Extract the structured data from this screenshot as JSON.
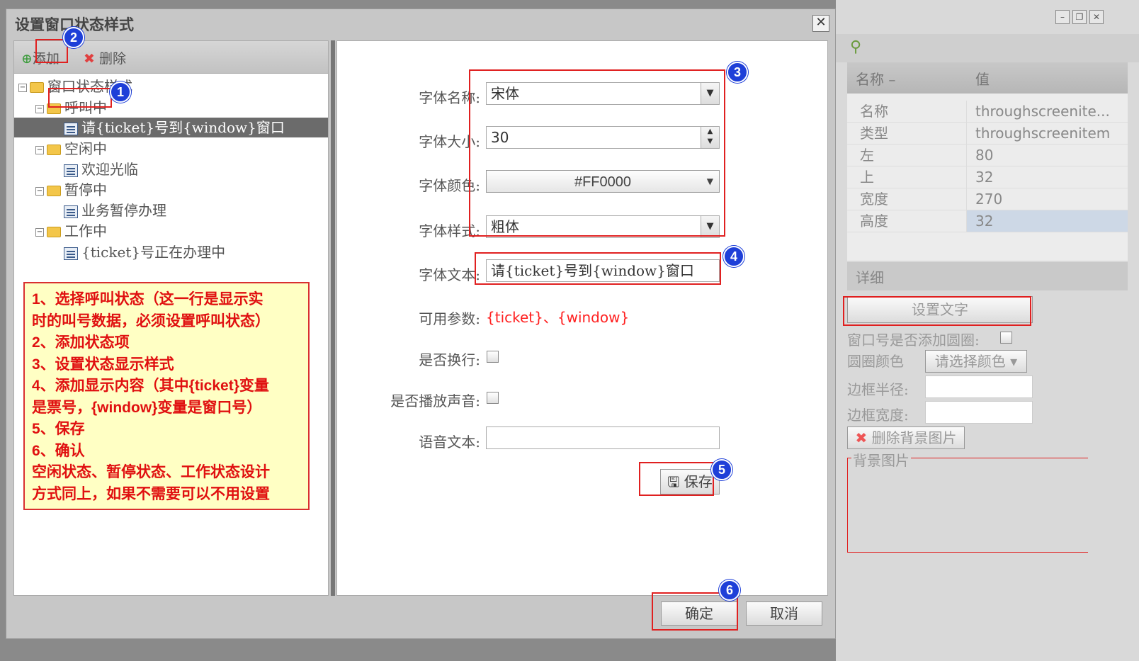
{
  "background": {
    "grid_header": {
      "name": "名称 –",
      "value": "值"
    },
    "properties": [
      {
        "name": "名称",
        "value": "throughscreenite..."
      },
      {
        "name": "类型",
        "value": "throughscreenitem"
      },
      {
        "name": "左",
        "value": "80"
      },
      {
        "name": "上",
        "value": "32"
      },
      {
        "name": "宽度",
        "value": "270"
      },
      {
        "name": "高度",
        "value": "32"
      }
    ],
    "detail_title": "详细",
    "set_text_button": "设置文字",
    "circle_label": "窗口号是否添加圆圈:",
    "circle_color_label": "圆圈颜色",
    "circle_color_select": "请选择颜色",
    "border_radius_label": "边框半径:",
    "border_width_label": "边框宽度:",
    "delete_bg_button": "删除背景图片",
    "bg_image_legend": "背景图片"
  },
  "dialog": {
    "title": "设置窗口状态样式",
    "close": "✕",
    "toolbar": {
      "add": "添加",
      "delete": "删除"
    },
    "tree": {
      "root": "窗口状态样式",
      "calling": "呼叫中",
      "calling_item": "请{ticket}号到{window}窗口",
      "idle": "空闲中",
      "idle_item": "欢迎光临",
      "paused": "暂停中",
      "paused_item": "业务暂停办理",
      "working": "工作中",
      "working_item": "{ticket}号正在办理中"
    },
    "form": {
      "font_name_label": "字体名称:",
      "font_name_value": "宋体",
      "font_size_label": "字体大小:",
      "font_size_value": "30",
      "font_color_label": "字体颜色:",
      "font_color_value": "#FF0000",
      "font_style_label": "字体样式:",
      "font_style_value": "粗体",
      "font_text_label": "字体文本:",
      "font_text_value": "请{ticket}号到{window}窗口",
      "params_label": "可用参数:",
      "params_value": "{ticket}、{window}",
      "wrap_label": "是否换行:",
      "sound_label": "是否播放声音:",
      "voice_label": "语音文本:",
      "voice_value": "",
      "save_button": "保存"
    },
    "ok_button": "确定",
    "cancel_button": "取消"
  },
  "annotations": {
    "badges": [
      "1",
      "2",
      "3",
      "4",
      "5",
      "6"
    ],
    "note_lines": [
      "1、选择呼叫状态（这一行是显示实",
      "时的叫号数据，必须设置呼叫状态）",
      "2、添加状态项",
      "3、设置状态显示样式",
      "4、添加显示内容（其中{ticket}变量",
      "是票号，{window}变量是窗口号）",
      "5、保存",
      "6、确认",
      "空闲状态、暂停状态、工作状态设计",
      "方式同上，如果不需要可以不用设置"
    ]
  },
  "colors": {
    "accent_red": "#e02020",
    "badge_blue": "#1e3fd8",
    "note_bg": "#ffffc4",
    "params_red": "#ff2020"
  }
}
